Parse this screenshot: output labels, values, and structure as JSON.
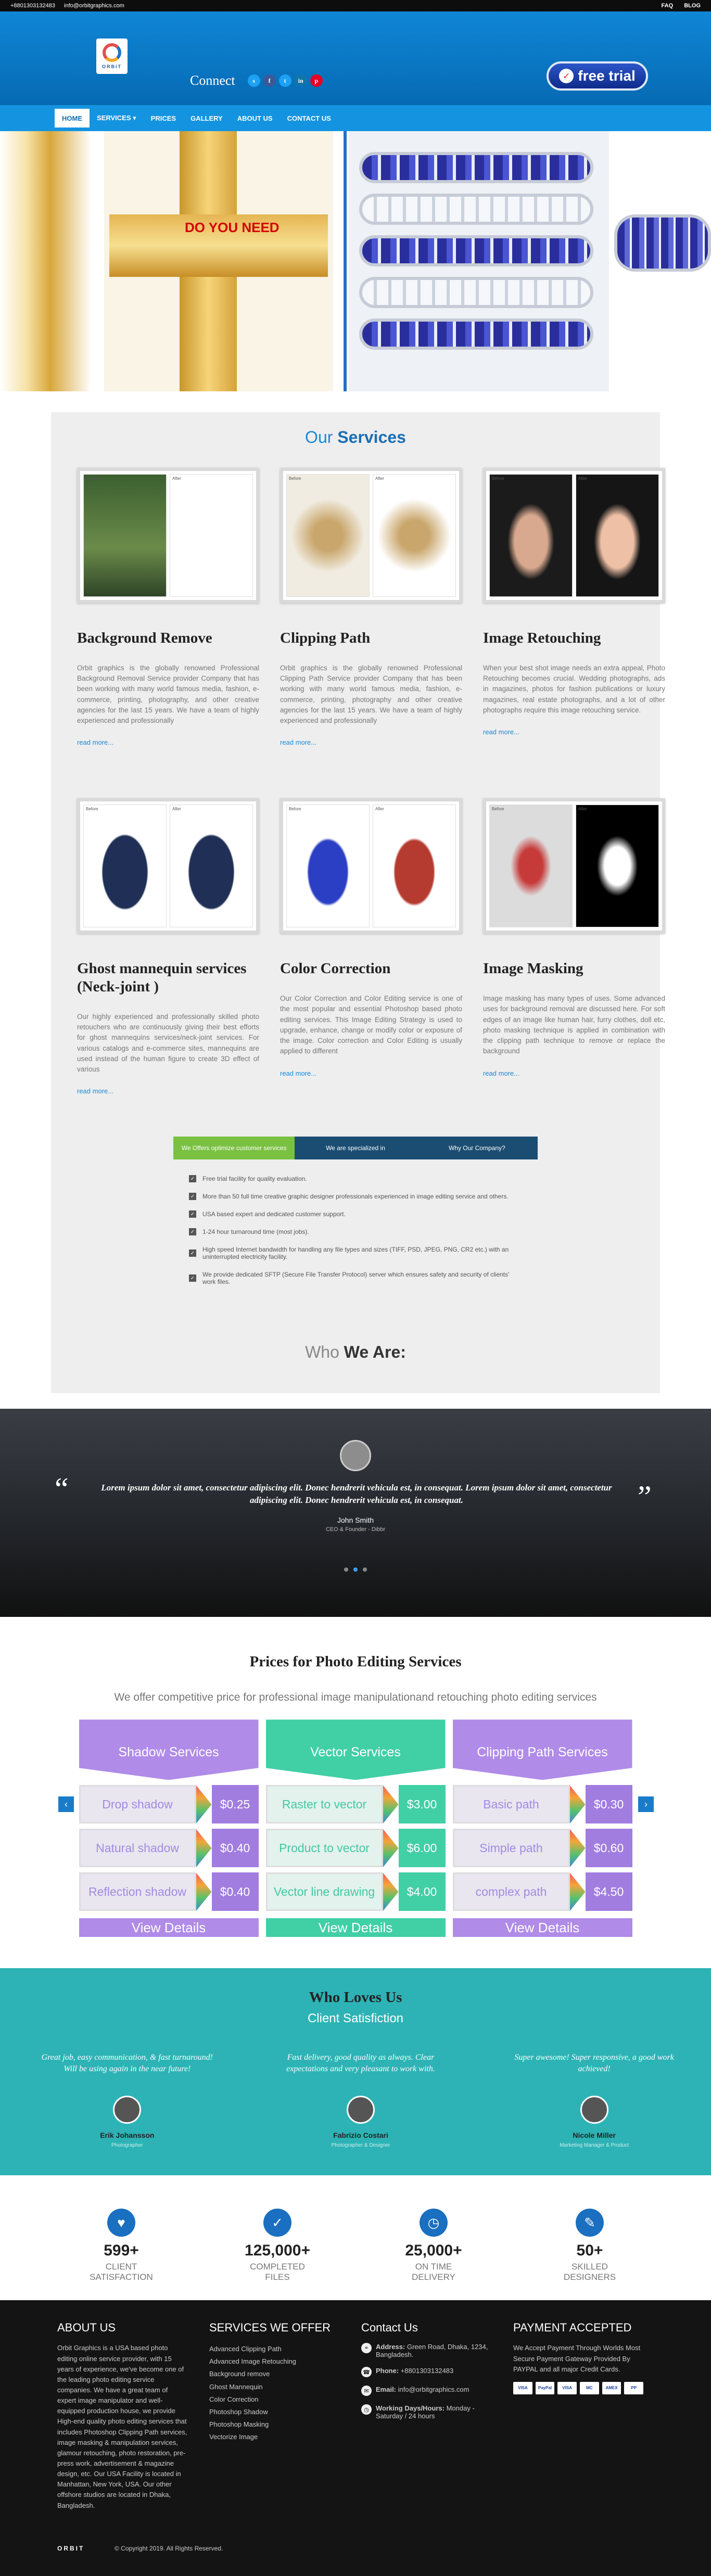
{
  "topbar": {
    "phone": "+8801303132483",
    "email": "info@orbitgraphics.com",
    "links": [
      "FAQ",
      "BLOG"
    ]
  },
  "header": {
    "logo_text": "ORBIT",
    "connect": "Connect",
    "social": [
      "s",
      "f",
      "t",
      "in",
      "p"
    ],
    "free_trial": "free trial"
  },
  "nav": [
    "HOME",
    "SERVICES ▾",
    "PRICES",
    "GALLERY",
    "ABOUT US",
    "CONTACT US"
  ],
  "hero": {
    "overlay_text": "DO YOU NEED"
  },
  "services": {
    "title_1": "Our ",
    "title_2": "Services",
    "items": [
      {
        "title": "Background Remove",
        "text": "Orbit graphics is the globally renowned Professional Background Removal Service provider Company that has been working with many world famous media, fashion, e-commerce, printing, photography, and other creative agencies for the last 15 years. We have a team of highly experienced and professionally",
        "more": "read more..."
      },
      {
        "title": "Clipping Path",
        "text": "Orbit graphics is the globally renowned Professional Clipping Path Service provider Company that has been working with many world famous media, fashion, e-commerce, printing, photography and other creative agencies for the last 15 years. We have a team of highly experienced and professionally",
        "more": "read more..."
      },
      {
        "title": "Image Retouching",
        "text": "When your best shot image needs an extra appeal, Photo Retouching becomes crucial. Wedding photographs, ads in magazines, photos for fashion publications or luxury magazines, real estate photographs, and a lot of other photographs require this image retouching service.",
        "more": "read more..."
      },
      {
        "title": "Ghost mannequin services (Neck-joint )",
        "text": "Our highly experienced and professionally skilled photo retouchers who are continuously giving their best efforts for ghost mannequins services/neck-joint services. For various catalogs and e-commerce sites, mannequins are used instead of the human figure to create 3D effect of various",
        "more": "read more..."
      },
      {
        "title": "Color Correction",
        "text": "Our Color Correction and Color Editing service is one of the most popular and essential Photoshop based photo editing services. This Image Editing Strategy is used to upgrade, enhance, change or modify color or exposure of the image. Color correction and Color Editing is usually applied to different",
        "more": "read more..."
      },
      {
        "title": "Image Masking",
        "text": "Image masking has many types of uses. Some advanced uses for background removal are discussed here. For soft edges of an image like human hair, furry clothes, doll etc, photo masking technique is applied in combination with the clipping path technique to remove or replace the background",
        "more": "read more..."
      }
    ],
    "before_label": "Before",
    "after_label": "After"
  },
  "tabs": [
    "We Offers optimize customer services",
    "We are specialized in",
    "Why Our Company?"
  ],
  "features": [
    "Free trial facility for quality evaluation.",
    "More than 50 full time creative graphic designer professionals experienced in image editing service and others.",
    "USA based expert and dedicated customer support.",
    "1-24 hour turnaround time (most jobs).",
    "High speed Internet bandwidth for handling any file types and sizes (TIFF, PSD, JPEG, PNG, CR2 etc.) with an uninterrupted electricity facility.",
    "We provide dedicated SFTP (Secure File Transfer Protocol) server which ensures safety and security of clients' work files."
  ],
  "who_we_are": {
    "title_1": "Who ",
    "title_2": "We Are:"
  },
  "testimonial": {
    "text": "Lorem ipsum dolor sit amet, consectetur adipiscing elit. Donec hendrerit vehicula est, in consequat. Lorem ipsum dolor sit amet, consectetur adipiscing elit. Donec hendrerit vehicula est, in consequat.",
    "name": "John Smith",
    "role": "CEO & Founder - Dibbr"
  },
  "prices": {
    "title": "Prices for Photo Editing Services",
    "subtitle": "We offer competitive price for professional image manipulationand retouching photo editing services",
    "columns": [
      {
        "head": "Shadow Services",
        "rows": [
          [
            "Drop shadow",
            "$0.25"
          ],
          [
            "Natural shadow",
            "$0.40"
          ],
          [
            "Reflection shadow",
            "$0.40"
          ]
        ],
        "button": "View Details",
        "theme": "purple"
      },
      {
        "head": "Vector Services",
        "rows": [
          [
            "Raster to vector",
            "$3.00"
          ],
          [
            "Product to vector",
            "$6.00"
          ],
          [
            "Vector line drawing",
            "$4.00"
          ]
        ],
        "button": "View Details",
        "theme": "green"
      },
      {
        "head": "Clipping Path Services",
        "rows": [
          [
            "Basic path",
            "$0.30"
          ],
          [
            "Simple path",
            "$0.60"
          ],
          [
            "complex path",
            "$4.50"
          ]
        ],
        "button": "View Details",
        "theme": "purple"
      }
    ],
    "prev": "‹",
    "next": "›"
  },
  "loves": {
    "title": "Who Loves Us",
    "subtitle": "Client Satisfiction",
    "items": [
      {
        "quote": "Great job, easy communication, & fast turnaround! Will be using again in the near future!",
        "name": "Erik Johansson",
        "role": "Photographer"
      },
      {
        "quote": "Fast delivery, good quality as always. Clear expectations and very pleasant to work with.",
        "name": "Fabrizio Costari",
        "role": "Photographer & Designer"
      },
      {
        "quote": "Super awesome! Super responsive, a good work achieved!",
        "name": "Nicole Miller",
        "role": "Marketing Manager & Product"
      }
    ]
  },
  "stats": [
    {
      "num": "599+",
      "label": "CLIENT SATISFACTION",
      "icon": "♥"
    },
    {
      "num": "125,000+",
      "label": "COMPLETED FILES",
      "icon": "✓"
    },
    {
      "num": "25,000+",
      "label": "ON TIME DELIVERY",
      "icon": "◷"
    },
    {
      "num": "50+",
      "label": "SKILLED DESIGNERS",
      "icon": "✎"
    }
  ],
  "footer": {
    "about_title": "ABOUT US",
    "about_text": "Orbit Graphics is a USA based photo editing online service provider, with 15 years of experience, we've become one of the leading photo editing service companies. We have a great team of expert image manipulator and well-equipped production house, we provide High-end quality photo editing services that includes Photoshop Clipping Path services, image masking & manipulation services, glamour retouching, photo restoration, pre-press work, advertisement & magazine design, etc. Our USA Facility is located in Manhattan, New York, USA. Our other offshore studios are located in Dhaka, Bangladesh.",
    "services_title": "SERVICES WE OFFER",
    "services": [
      "Advanced Clipping Path",
      "Advanced Image Retouching",
      "Background remove",
      "Ghost Mannequin",
      "Color Correction",
      "Photoshop Shadow",
      "Photoshop Masking",
      "Vectorize Image"
    ],
    "contact_title": "Contact Us",
    "address_label": "Address:",
    "address": "Green Road, Dhaka, 1234, Bangladesh.",
    "phone_label": "Phone:",
    "phone": "+8801303132483",
    "email_label": "Email:",
    "email": "info@orbitgraphics.com",
    "hours_label": "Working Days/Hours:",
    "hours": "Monday - Saturday / 24 hours",
    "payment_title": "PAYMENT ACCEPTED",
    "payment_text": "We Accept Payment Through Worlds Most Secure Payment Gateway Provided By PAYPAL and all major Credit Cards.",
    "cards": [
      "VISA",
      "PayPal",
      "VISA",
      "MC",
      "AMEX",
      "PP"
    ],
    "logo": "ORBIT",
    "copyright": "© Copyright 2019. All Rights Reserved."
  },
  "colors": {
    "brand_blue": "#1494e0",
    "teal": "#2db3b5",
    "purple": "#b08be8",
    "green": "#41cfa6"
  }
}
